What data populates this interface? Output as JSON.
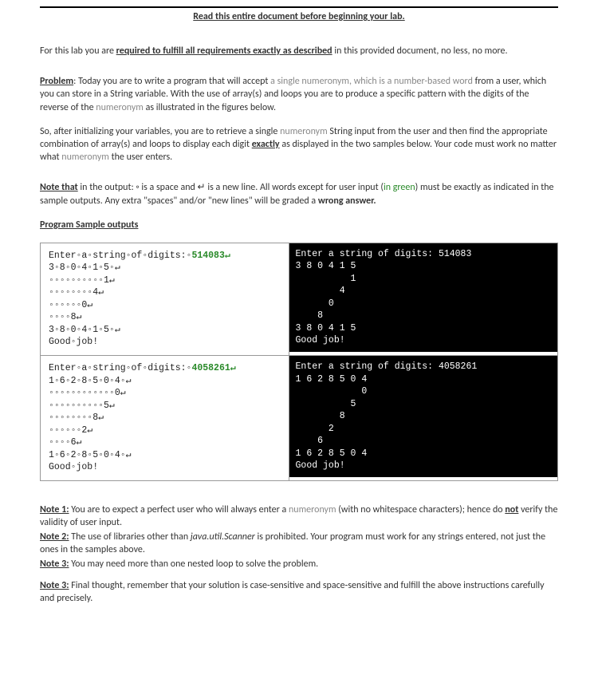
{
  "heading": "Read this entire document before beginning your lab.",
  "intro_pre": "For this lab you are ",
  "intro_req": "required to fulfill all requirements exactly as described",
  "intro_post": " in this provided document, no less, no more.",
  "problem_label": "Problem",
  "p1_a": ": Today you are to write a program that will accept ",
  "p1_b": "a single numeronym, which is a number-based word",
  "p1_c": " from a user, which you can store in a String variable. With the use of array(s) and loops you are to produce a specific pattern with the digits of the reverse of the ",
  "p1_d": "numeronym",
  "p1_e": " as illustrated in the figures below.",
  "p2_a": "So, after initializing your variables, you are to retrieve a single ",
  "p2_b": "numeronym",
  "p2_c": " String input from the user and then find the appropriate combination of array(s) and loops to display each digit ",
  "p2_d": "exactly",
  "p2_e": " as displayed in the two samples below. Your code must work no matter what ",
  "p2_f": "numeronym",
  "p2_g": " the user enters.",
  "note_label": "Note that",
  "n1_a": " in the output: ◦ is a space and ↵ is a new line. All words except for user input (",
  "n1_b": "in green",
  "n1_c": ") must be exactly as indicated in the sample outputs. Any extra \"spaces\" and/or \"new lines\" will be graded a ",
  "n1_d": "wrong answer.",
  "pso_label": "Program Sample outputs",
  "sample1_left_prefix": "Enter◦a◦string◦of◦digits:◦",
  "sample1_left_input": "514083↵",
  "sample1_left_body": "3◦8◦0◦4◦1◦5◦↵\n◦◦◦◦◦◦◦◦◦◦1↵\n◦◦◦◦◦◦◦◦4↵\n◦◦◦◦◦◦0↵\n◦◦◦◦8↵\n3◦8◦0◦4◦1◦5◦↵\nGood◦job!",
  "sample1_right": "Enter a string of digits: 514083\n3 8 0 4 1 5\n          1\n        4\n      0\n    8\n3 8 0 4 1 5\nGood job!",
  "sample2_left_prefix": "Enter◦a◦string◦of◦digits:◦",
  "sample2_left_input": "4058261↵",
  "sample2_left_body": "1◦6◦2◦8◦5◦0◦4◦↵\n◦◦◦◦◦◦◦◦◦◦◦◦0↵\n◦◦◦◦◦◦◦◦◦◦5↵\n◦◦◦◦◦◦◦◦8↵\n◦◦◦◦◦◦2↵\n◦◦◦◦6↵\n1◦6◦2◦8◦5◦0◦4◦↵\nGood◦job!",
  "sample2_right": "Enter a string of digits: 4058261\n1 6 2 8 5 0 4\n            0\n          5\n        8\n      2\n    6\n1 6 2 8 5 0 4\nGood job!",
  "note1_label": "Note 1:",
  "note1_a": " You are to expect a perfect user who will always enter a ",
  "note1_b": "numeronym",
  "note1_c": " (with no whitespace characters); hence do ",
  "note1_d": "not",
  "note1_e": " verify the validity of user input.",
  "note2_label": "Note 2:",
  "note2_a": " The use of libraries other than ",
  "note2_b": "java.util.Scanner",
  "note2_c": " is prohibited. Your program must work for any strings entered, not just the ones in the samples above.",
  "note3_label": "Note 3:",
  "note3_a": " You may need more than one nested loop to solve the problem.",
  "note3b_label": "Note 3:",
  "note3b_a": " Final thought, remember that your solution is case-sensitive and space-sensitive and fulfill the above instructions carefully and precisely."
}
